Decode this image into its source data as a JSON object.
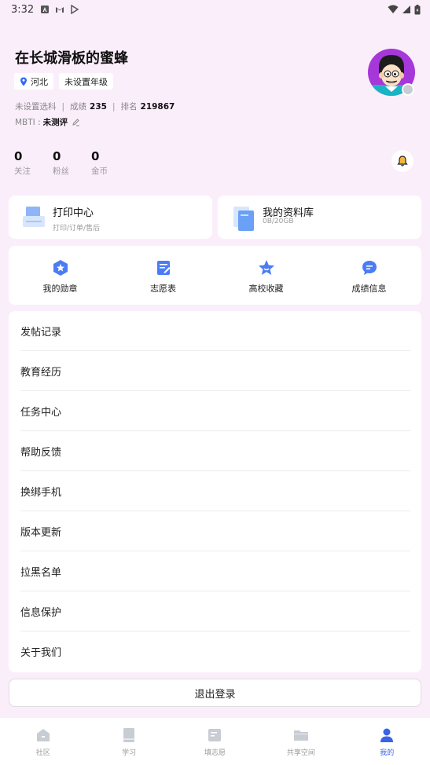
{
  "status_bar": {
    "time": "3:32"
  },
  "profile": {
    "username": "在长城滑板的蜜蜂",
    "location": "河北",
    "grade": "未设置年级",
    "subject": "未设置选科",
    "score_label": "成绩",
    "score_value": "235",
    "rank_label": "排名",
    "rank_value": "219867",
    "mbti_label": "MBTI :",
    "mbti_value": "未测评"
  },
  "stats": [
    {
      "num": "0",
      "label": "关注"
    },
    {
      "num": "0",
      "label": "粉丝"
    },
    {
      "num": "0",
      "label": "金币"
    }
  ],
  "cards": {
    "print": {
      "title": "打印中心",
      "sub": "打印/订单/售后"
    },
    "library": {
      "title": "我的资料库",
      "sub": "0B/20GB"
    }
  },
  "quick_actions": [
    {
      "label": "我的勋章",
      "icon": "medal-icon"
    },
    {
      "label": "志愿表",
      "icon": "form-icon"
    },
    {
      "label": "高校收藏",
      "icon": "star-icon"
    },
    {
      "label": "成绩信息",
      "icon": "chat-icon"
    }
  ],
  "menu": [
    "发帖记录",
    "教育经历",
    "任务中心",
    "帮助反馈",
    "换绑手机",
    "版本更新",
    "拉黑名单",
    "信息保护",
    "关于我们"
  ],
  "logout_label": "退出登录",
  "bottom_nav": [
    {
      "label": "社区",
      "icon": "home-icon"
    },
    {
      "label": "学习",
      "icon": "book-icon"
    },
    {
      "label": "填志愿",
      "icon": "doc-icon"
    },
    {
      "label": "共享空间",
      "icon": "folder-icon"
    },
    {
      "label": "我的",
      "icon": "person-icon",
      "active": true
    }
  ],
  "colors": {
    "accent": "#3b63e8",
    "background": "#fbeefb",
    "icon_blue": "#4a7cf6"
  }
}
